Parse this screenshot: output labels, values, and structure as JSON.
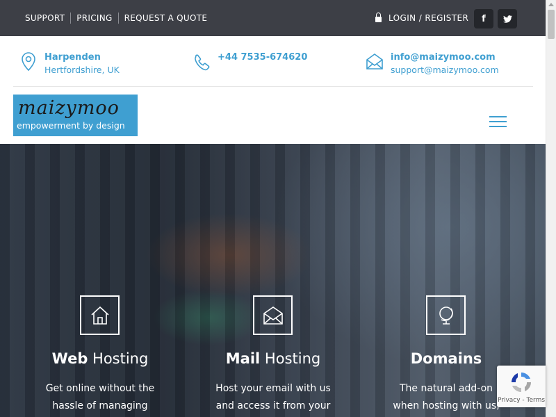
{
  "topbar": {
    "links": [
      "SUPPORT",
      "PRICING",
      "REQUEST A QUOTE"
    ],
    "login_label": "LOGIN / REGISTER",
    "social": {
      "facebook_glyph": "f",
      "twitter_glyph": "t"
    }
  },
  "contact": {
    "location": {
      "title": "Harpenden",
      "subtitle": "Hertfordshire, UK",
      "icon": "map-pin-icon"
    },
    "phone": {
      "title": "+44 7535-674620",
      "icon": "phone-icon"
    },
    "email": {
      "title": "info@maizymoo.com",
      "subtitle": "support@maizymoo.com",
      "icon": "envelope-icon"
    }
  },
  "brand": {
    "name": "maizymoo",
    "tagline": "empowerment by design"
  },
  "features": [
    {
      "bold": "Web",
      "rest": " Hosting",
      "text_line1": "Get online without the",
      "text_line2": "hassle of managing",
      "icon": "house-icon"
    },
    {
      "bold": "Mail",
      "rest": " Hosting",
      "text_line1": "Host your email with us",
      "text_line2": "and access it from your",
      "icon": "envelope-icon"
    },
    {
      "bold": "Domains",
      "rest": "",
      "text_line1": "The natural add-on",
      "text_line2": "when hosting with us,",
      "icon": "globe-icon"
    }
  ],
  "recaptcha": {
    "links": "Privacy - Terms"
  },
  "colors": {
    "accent": "#3f9fd1",
    "topbar": "#3d3f46"
  }
}
